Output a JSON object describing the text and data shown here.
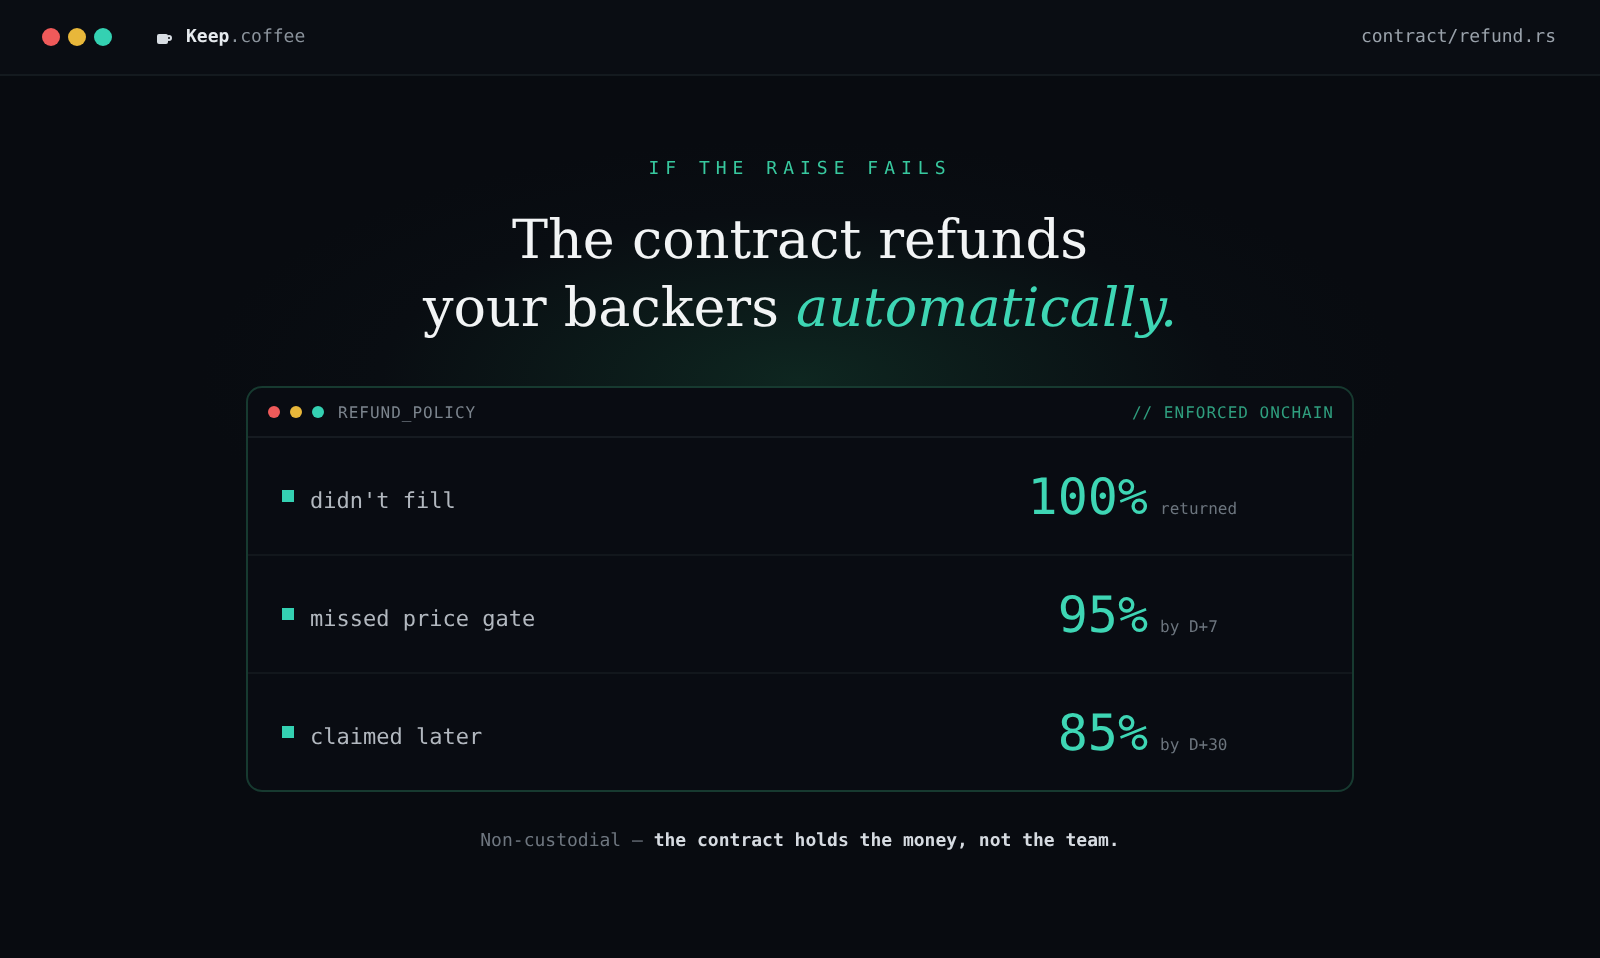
{
  "topbar": {
    "brand": "**Keep**.coffee",
    "file": "contract/refund.rs"
  },
  "hero": {
    "eyebrow": "IF THE RAISE FAILS",
    "headline_line1": "The contract refunds",
    "headline_line2": "your backers *automatically.*"
  },
  "panel": {
    "title": "REFUND_POLICY",
    "tag": "// ENFORCED ONCHAIN",
    "rows": [
      {
        "label": "didn't fill",
        "percent": "100%",
        "note": "returned"
      },
      {
        "label": "missed price gate",
        "percent": "95%",
        "note": "by D+7"
      },
      {
        "label": "claimed later",
        "percent": "85%",
        "note": "by D+30"
      }
    ]
  },
  "footer": "Non-custodial — **the contract holds the money, not the team.**"
}
